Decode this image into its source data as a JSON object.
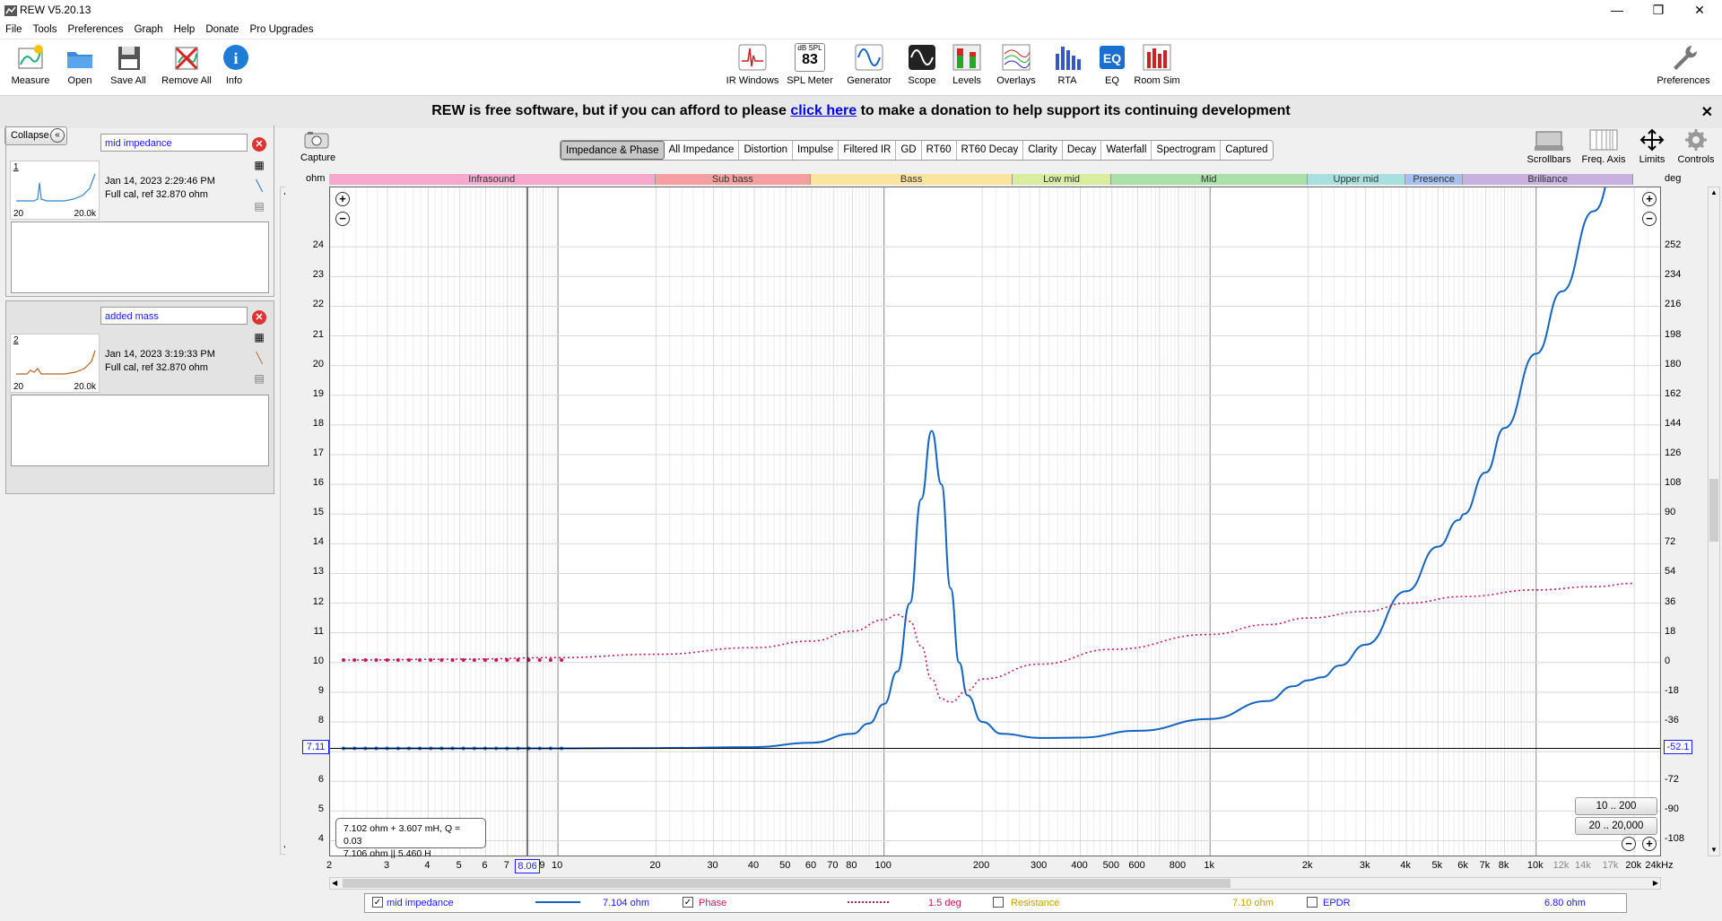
{
  "window": {
    "title": "REW V5.20.13"
  },
  "menu": [
    "File",
    "Tools",
    "Preferences",
    "Graph",
    "Help",
    "Donate",
    "Pro Upgrades"
  ],
  "toolbar_left": [
    {
      "label": "Measure",
      "icon": "measure-icon"
    },
    {
      "label": "Open",
      "icon": "folder-icon"
    },
    {
      "label": "Save All",
      "icon": "floppy-icon"
    },
    {
      "label": "Remove All",
      "icon": "remove-all-icon"
    },
    {
      "label": "Info",
      "icon": "info-icon"
    }
  ],
  "toolbar_center": [
    {
      "label": "IR Windows",
      "icon": "ir-windows-icon"
    },
    {
      "label": "SPL Meter",
      "icon": "spl-meter-icon",
      "value": "83",
      "unit": "dB SPL"
    },
    {
      "label": "Generator",
      "icon": "generator-icon"
    },
    {
      "label": "Scope",
      "icon": "scope-icon"
    },
    {
      "label": "Levels",
      "icon": "levels-icon"
    },
    {
      "label": "Overlays",
      "icon": "overlays-icon"
    },
    {
      "label": "RTA",
      "icon": "rta-icon"
    },
    {
      "label": "EQ",
      "icon": "eq-icon"
    },
    {
      "label": "Room Sim",
      "icon": "room-sim-icon"
    }
  ],
  "toolbar_right": {
    "label": "Preferences",
    "icon": "wrench-icon"
  },
  "banner": {
    "before": "REW is free software, but if you can afford to please ",
    "link": "click here",
    "after": " to make a donation to help support its continuing development"
  },
  "left_panel": {
    "collapse_label": "Collapse",
    "measurements": [
      {
        "number": "1",
        "name": "mid impedance",
        "date": "Jan 14, 2023 2:29:46 PM",
        "cal": "Full cal, ref 32.870 ohm",
        "thumb_min": "20",
        "thumb_max": "20.0k",
        "color": "#3a86c8"
      },
      {
        "number": "2",
        "name": "added mass",
        "date": "Jan 14, 2023 3:19:33 PM",
        "cal": "Full cal, ref 32.870 ohm",
        "thumb_min": "20",
        "thumb_max": "20.0k",
        "color": "#b5651d"
      }
    ]
  },
  "capture_label": "Capture",
  "tabs": [
    "Impedance & Phase",
    "All Impedance",
    "Distortion",
    "Impulse",
    "Filtered IR",
    "GD",
    "RT60",
    "RT60 Decay",
    "Clarity",
    "Decay",
    "Waterfall",
    "Spectrogram",
    "Captured"
  ],
  "selected_tab": "Impedance & Phase",
  "right_tools": [
    {
      "label": "Scrollbars",
      "icon": "scrollbars-icon"
    },
    {
      "label": "Freq. Axis",
      "icon": "freq-axis-icon"
    },
    {
      "label": "Limits",
      "icon": "limits-icon"
    },
    {
      "label": "Controls",
      "icon": "gear-icon"
    }
  ],
  "bands": [
    {
      "label": "Infrasound",
      "f0": 2,
      "f1": 20,
      "color": "#f7a8cf"
    },
    {
      "label": "Sub bass",
      "f0": 20,
      "f1": 60,
      "color": "#f5a0a0"
    },
    {
      "label": "Bass",
      "f0": 60,
      "f1": 250,
      "color": "#fbe3a0"
    },
    {
      "label": "Low mid",
      "f0": 250,
      "f1": 500,
      "color": "#d8ee9e"
    },
    {
      "label": "Mid",
      "f0": 500,
      "f1": 2000,
      "color": "#a8e0a8"
    },
    {
      "label": "Upper mid",
      "f0": 2000,
      "f1": 4000,
      "color": "#a8e0e0"
    },
    {
      "label": "Presence",
      "f0": 4000,
      "f1": 6000,
      "color": "#a8c0f0"
    },
    {
      "label": "Brilliance",
      "f0": 6000,
      "f1": 20000,
      "color": "#c8b0e0"
    }
  ],
  "axes": {
    "left_unit": "ohm",
    "right_unit": "deg",
    "left_ticks": [
      "24",
      "23",
      "22",
      "21",
      "20",
      "19",
      "18",
      "17",
      "16",
      "15",
      "14",
      "13",
      "12",
      "11",
      "10",
      "9",
      "8",
      "7",
      "6",
      "5",
      "4"
    ],
    "right_ticks": [
      "252",
      "234",
      "216",
      "198",
      "180",
      "162",
      "144",
      "126",
      "108",
      "90",
      "72",
      "54",
      "36",
      "18",
      "0",
      "-18",
      "-36",
      "-54",
      "-72",
      "-90",
      "-108"
    ],
    "x_ticks": [
      {
        "f": 2,
        "t": "2"
      },
      {
        "f": 3,
        "t": "3"
      },
      {
        "f": 4,
        "t": "4"
      },
      {
        "f": 5,
        "t": "5"
      },
      {
        "f": 6,
        "t": "6"
      },
      {
        "f": 7,
        "t": "7"
      },
      {
        "f": 9,
        "t": "9"
      },
      {
        "f": 10,
        "t": "10"
      },
      {
        "f": 20,
        "t": "20"
      },
      {
        "f": 30,
        "t": "30"
      },
      {
        "f": 40,
        "t": "40"
      },
      {
        "f": 50,
        "t": "50"
      },
      {
        "f": 60,
        "t": "60"
      },
      {
        "f": 70,
        "t": "70"
      },
      {
        "f": 80,
        "t": "80"
      },
      {
        "f": 100,
        "t": "100"
      },
      {
        "f": 200,
        "t": "200"
      },
      {
        "f": 300,
        "t": "300"
      },
      {
        "f": 400,
        "t": "400"
      },
      {
        "f": 500,
        "t": "500"
      },
      {
        "f": 600,
        "t": "600"
      },
      {
        "f": 800,
        "t": "800"
      },
      {
        "f": 1000,
        "t": "1k"
      },
      {
        "f": 2000,
        "t": "2k"
      },
      {
        "f": 3000,
        "t": "3k"
      },
      {
        "f": 4000,
        "t": "4k"
      },
      {
        "f": 5000,
        "t": "5k"
      },
      {
        "f": 6000,
        "t": "6k"
      },
      {
        "f": 7000,
        "t": "7k"
      },
      {
        "f": 8000,
        "t": "8k"
      },
      {
        "f": 10000,
        "t": "10k"
      },
      {
        "f": 12000,
        "t": "12k",
        "minor": true
      },
      {
        "f": 14000,
        "t": "14k",
        "minor": true
      },
      {
        "f": 17000,
        "t": "17k",
        "minor": true
      },
      {
        "f": 20000,
        "t": "20k"
      },
      {
        "f": 24000,
        "t": "24kHz"
      }
    ],
    "cursor_freq": "8.06",
    "cursor_left_value": "7.11",
    "cursor_right_value": "-52.1"
  },
  "readout": {
    "line1": "7.102 ohm + 3.607 mH, Q = 0.03",
    "line2": "7.106 ohm || 5.460 H"
  },
  "range_buttons": [
    "10 .. 200",
    "20 .. 20,000"
  ],
  "legend": [
    {
      "name": "mid impedance",
      "value": "7.104 ohm",
      "checked": true,
      "color": "#1a1aff",
      "line": "#1565c0",
      "style": "solid"
    },
    {
      "name": "Phase",
      "value": "1.5 deg",
      "checked": true,
      "color": "#c2185b",
      "line": "#c2185b",
      "style": "dotted"
    },
    {
      "name": "Resistance",
      "value": "7.10 ohm",
      "checked": false,
      "color": "#c9a000",
      "line": "",
      "style": ""
    },
    {
      "name": "EPDR",
      "value": "6.80 ohm",
      "checked": false,
      "color": "#1a1aff",
      "line": "",
      "style": ""
    }
  ],
  "chart_data": {
    "type": "line",
    "xscale": "log",
    "xlim": [
      2,
      24000
    ],
    "ylim": [
      3.5,
      26
    ],
    "y2lim": [
      -117,
      288
    ],
    "series": [
      {
        "name": "mid impedance",
        "axis": "left",
        "color": "#1565c0",
        "x": [
          2.2,
          5,
          10,
          20,
          40,
          60,
          80,
          90,
          100,
          110,
          120,
          130,
          140,
          150,
          160,
          170,
          180,
          200,
          230,
          300,
          400,
          600,
          1000,
          1500,
          1800,
          2000,
          2200,
          2500,
          3000,
          4000,
          5000,
          5800,
          6000,
          7000,
          8000,
          10000,
          12000,
          15000,
          18000,
          20000
        ],
        "y": [
          7.11,
          7.11,
          7.11,
          7.12,
          7.15,
          7.3,
          7.6,
          7.95,
          8.6,
          9.7,
          12,
          15.5,
          17.8,
          16,
          12.5,
          10,
          8.9,
          8.0,
          7.6,
          7.46,
          7.47,
          7.7,
          8.1,
          8.7,
          9.2,
          9.4,
          9.5,
          9.9,
          10.6,
          12.4,
          13.9,
          14.8,
          15.0,
          16.4,
          17.9,
          20.4,
          22.5,
          25.2,
          27.2,
          28.5
        ]
      },
      {
        "name": "Phase",
        "axis": "right",
        "color": "#c2185b",
        "x": [
          2.2,
          5,
          10,
          20,
          40,
          60,
          80,
          100,
          110,
          120,
          130,
          140,
          150,
          160,
          180,
          200,
          300,
          500,
          1000,
          1500,
          2000,
          3000,
          4000,
          6000,
          10000,
          15000,
          20000
        ],
        "y": [
          1.5,
          2,
          3,
          5,
          9,
          13,
          19,
          26,
          29,
          25,
          10,
          -10,
          -22,
          -24,
          -17,
          -10,
          -1,
          8,
          17,
          23,
          27,
          31,
          36,
          40,
          44,
          46,
          48
        ]
      }
    ]
  }
}
